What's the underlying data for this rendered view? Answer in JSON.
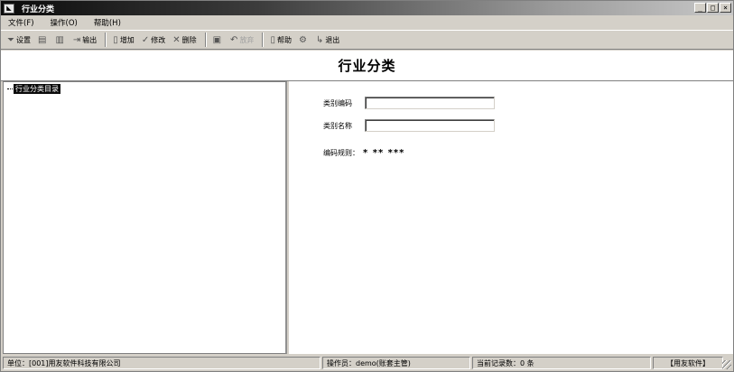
{
  "window": {
    "title": "行业分类",
    "controls": {
      "minimize": "_",
      "maximize": "□",
      "close": "×"
    }
  },
  "menu": [
    {
      "label": "文件(F)"
    },
    {
      "label": "操作(O)"
    },
    {
      "label": "帮助(H)"
    }
  ],
  "toolbar": {
    "buttons": [
      {
        "label": "设置",
        "icon": "funnel-icon"
      },
      {
        "label": "",
        "icon": "print-icon"
      },
      {
        "label": "",
        "icon": "preview-icon"
      },
      {
        "label": "输出",
        "icon": "export-icon"
      },
      {
        "label": "增加",
        "icon": "add-icon"
      },
      {
        "label": "修改",
        "icon": "edit-icon"
      },
      {
        "label": "删除",
        "icon": "delete-icon"
      },
      {
        "label": "",
        "icon": "save-icon"
      },
      {
        "label": "放弃",
        "icon": "undo-icon",
        "disabled": true
      },
      {
        "label": "帮助",
        "icon": "help-icon"
      },
      {
        "label": "",
        "icon": "gear-icon"
      },
      {
        "label": "退出",
        "icon": "exit-icon"
      }
    ]
  },
  "header": {
    "title": "行业分类"
  },
  "tree": {
    "root_label": "行业分类目录"
  },
  "form": {
    "code_label": "类别编码",
    "code_value": "",
    "name_label": "类别名称",
    "name_value": "",
    "rule_label": "编码规则：",
    "rule_value": "* ** ***"
  },
  "status": {
    "unit": "单位：[001]用友软件科技有限公司",
    "operator": "操作员：demo(账套主管)",
    "record_count": "当前记录数：0 条",
    "brand": "【用友软件】"
  }
}
